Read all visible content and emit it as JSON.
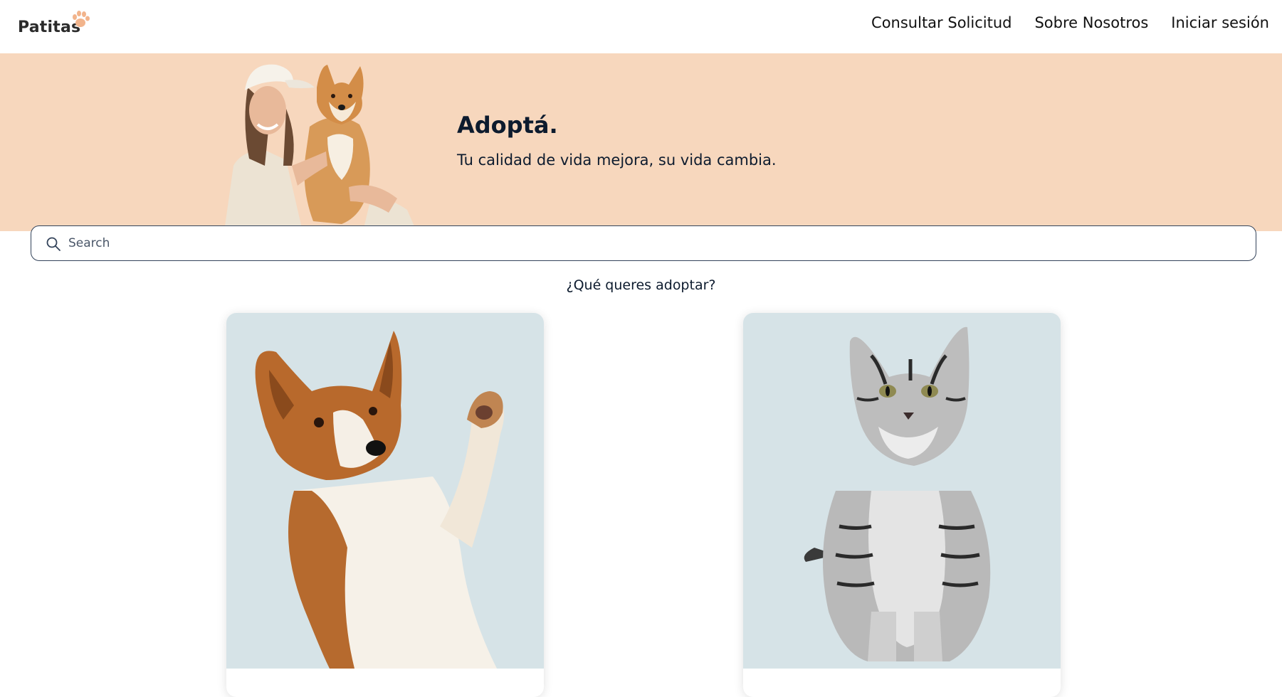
{
  "header": {
    "logo_text": "Patitas",
    "logo_icon": "paw-icon",
    "nav": [
      {
        "label": "Consultar Solicitud"
      },
      {
        "label": "Sobre Nosotros"
      },
      {
        "label": "Iniciar sesión"
      }
    ]
  },
  "hero": {
    "title": "Adoptá.",
    "subtitle": "Tu calidad de vida mejora, su vida cambia.",
    "background_color": "#f7d7bd"
  },
  "search": {
    "placeholder": "Search",
    "value": "",
    "icon": "search-icon"
  },
  "prompt": "¿Qué queres adoptar?",
  "cards": [
    {
      "animal": "dog",
      "image": "dog-photo"
    },
    {
      "animal": "cat",
      "image": "cat-photo"
    }
  ],
  "colors": {
    "card_bg": "#d6e3e7",
    "text": "#0d1b2e",
    "accent": "#f2b48c"
  }
}
